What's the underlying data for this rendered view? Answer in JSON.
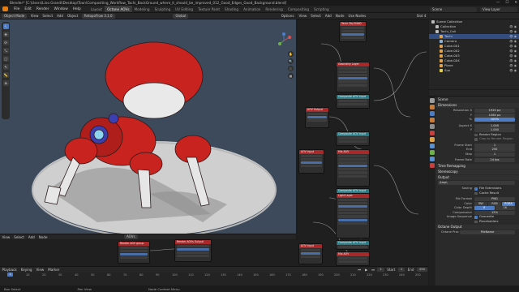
{
  "app": {
    "title": "Blender* [C:\\Users\\Lino Grandi\\Desktop\\Toon\\Compositing_Workflow_Tachi_BackGround_where_it_should_be_improved_012_Good_Edges_Good_Background.blend]",
    "window_controls": [
      "—",
      "☐",
      "✕"
    ]
  },
  "menubar": {
    "items": [
      "File",
      "Edit",
      "Render",
      "Window",
      "Help"
    ],
    "workspaces": [
      "Layout",
      "Octane AOVs",
      "Modeling",
      "Sculpting",
      "UV Editing",
      "Texture Paint",
      "Shading",
      "Animation",
      "Rendering",
      "Compositing",
      "Scripting"
    ],
    "active_workspace": "Octane AOVs",
    "scene": "Scene",
    "view_layer": "View Layer"
  },
  "viewport_header": {
    "mode": "Object Mode",
    "items": [
      "View",
      "Select",
      "Add",
      "Object"
    ],
    "render_preset": "RetopoFlow 3.1.0",
    "transform": "Global",
    "options": "Options"
  },
  "viewport_tools": [
    "↖",
    "✥",
    "⟳",
    "⤡",
    "◻",
    "✎",
    "📏",
    "⊕"
  ],
  "viewport_nav": [
    "✋",
    "🔍",
    "🎥",
    "▦"
  ],
  "node_editor_header": {
    "items": [
      "View",
      "Select",
      "Add",
      "Node"
    ],
    "use_nodes_label": "Use Nodes",
    "slot": "Slot 4",
    "material": "Material_cane",
    "tree": "Comp"
  },
  "nodes": [
    {
      "title": "Tachi Obj SHAD",
      "color": "red"
    },
    {
      "title": "Geometry Layer",
      "color": "red"
    },
    {
      "title": "Composite AOV input",
      "color": "teal"
    },
    {
      "title": "AOV Output",
      "color": "red"
    },
    {
      "title": "AOV input",
      "color": "red"
    },
    {
      "title": "Composite AOV input",
      "color": "teal"
    },
    {
      "title": "Mix AOV",
      "color": "red"
    },
    {
      "title": "Composite AOV input",
      "color": "teal"
    },
    {
      "title": "Light Layer",
      "color": "red"
    },
    {
      "title": "Composite AOV input",
      "color": "teal"
    },
    {
      "title": "AOV input",
      "color": "red"
    },
    {
      "title": "Mix AOV",
      "color": "red"
    }
  ],
  "node_bottom_header": {
    "items": [
      "View",
      "Select",
      "Add",
      "Node"
    ],
    "tree": "AOVs"
  },
  "bottom_nodes": [
    {
      "title": "Render AOV group",
      "color": "red"
    },
    {
      "title": "Render AOVs Output",
      "color": "red"
    }
  ],
  "outliner": {
    "title": "Scene Collection",
    "rows": [
      {
        "label": "Scene Collection",
        "indent": 0,
        "color": "#bdbdbd"
      },
      {
        "label": "Collection",
        "indent": 1,
        "color": "#bdbdbd"
      },
      {
        "label": "Tachi_Coll",
        "indent": 1,
        "color": "#bdbdbd"
      },
      {
        "label": "Tachi",
        "indent": 2,
        "color": "#e0a34a",
        "selected": true
      },
      {
        "label": "Camera",
        "indent": 2,
        "color": "#8fb0d8"
      },
      {
        "label": "Cube.001",
        "indent": 2,
        "color": "#e0a34a"
      },
      {
        "label": "Cube.002",
        "indent": 2,
        "color": "#e0a34a"
      },
      {
        "label": "Cube.003",
        "indent": 2,
        "color": "#e0a34a"
      },
      {
        "label": "Cube.004",
        "indent": 2,
        "color": "#e0a34a"
      },
      {
        "label": "Plane",
        "indent": 2,
        "color": "#e0a34a"
      },
      {
        "label": "Sun",
        "indent": 2,
        "color": "#e0d14a"
      }
    ]
  },
  "properties": {
    "title": "Scene",
    "sections": {
      "dimensions": "Dimensions",
      "resolution_x_label": "Resolution X",
      "resolution_x": "1920 px",
      "resolution_y_label": "Y",
      "resolution_y": "1080 px",
      "resolution_pct_label": "%",
      "resolution_pct": "100%",
      "aspect_x_label": "Aspect X",
      "aspect_x": "1.000",
      "aspect_y_label": "Y",
      "aspect_y": "1.000",
      "render_region": "Render Region",
      "crop_region": "Crop to Render Region",
      "frame_start_label": "Frame Start",
      "frame_start": "1",
      "frame_end_label": "End",
      "frame_end": "250",
      "frame_step_label": "Step",
      "frame_step": "1",
      "frame_rate_label": "Frame Rate",
      "frame_rate": "24 fps",
      "time_remapping": "Time Remapping",
      "stereoscopy": "Stereoscopy",
      "output": "Output",
      "output_path": "/tmp\\",
      "saving_label": "Saving",
      "file_extensions": "File Extensions",
      "cache_result": "Cache Result",
      "file_format_label": "File Format",
      "file_format": "PNG",
      "color_label": "Color",
      "color_options": [
        "BW",
        "RGB",
        "RGBA"
      ],
      "color_selected": "RGBA",
      "color_depth_label": "Color Depth",
      "color_depth_options": [
        "8",
        "16"
      ],
      "color_depth_selected": "8",
      "compression_label": "Compression",
      "compression": "15%",
      "image_sequence_label": "Image Sequence",
      "overwrite": "Overwrite",
      "placeholders": "Placeholders",
      "octane_output": "Octane Output",
      "octane_file_label": "Octane Proc",
      "octane_file": "FileName"
    }
  },
  "timeline": {
    "items": [
      "Playback",
      "Keying",
      "View",
      "Marker"
    ],
    "current_frame": "1",
    "start_label": "Start",
    "start": "1",
    "end_label": "End",
    "end": "250",
    "ticks": [
      "0",
      "10",
      "20",
      "30",
      "40",
      "50",
      "60",
      "70",
      "80",
      "90",
      "100",
      "110",
      "120",
      "130",
      "140",
      "150",
      "160",
      "170",
      "180",
      "190",
      "200",
      "210",
      "220",
      "230",
      "240",
      "250"
    ]
  },
  "status": {
    "items": [
      "Box Select",
      "Pan View",
      "Node Context Menu"
    ]
  }
}
